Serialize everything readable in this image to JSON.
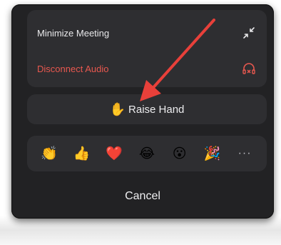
{
  "menu": {
    "minimize_label": "Minimize Meeting",
    "disconnect_label": "Disconnect Audio"
  },
  "raise_hand": {
    "emoji": "✋",
    "label": "Raise Hand"
  },
  "reactions": [
    "👏",
    "👍",
    "❤️",
    "😂",
    "😮",
    "🎉"
  ],
  "more_label": "···",
  "cancel_label": "Cancel",
  "colors": {
    "sheet": "#222224",
    "card": "#2e2e31",
    "danger": "#e8584f",
    "arrow": "#e8403a"
  }
}
